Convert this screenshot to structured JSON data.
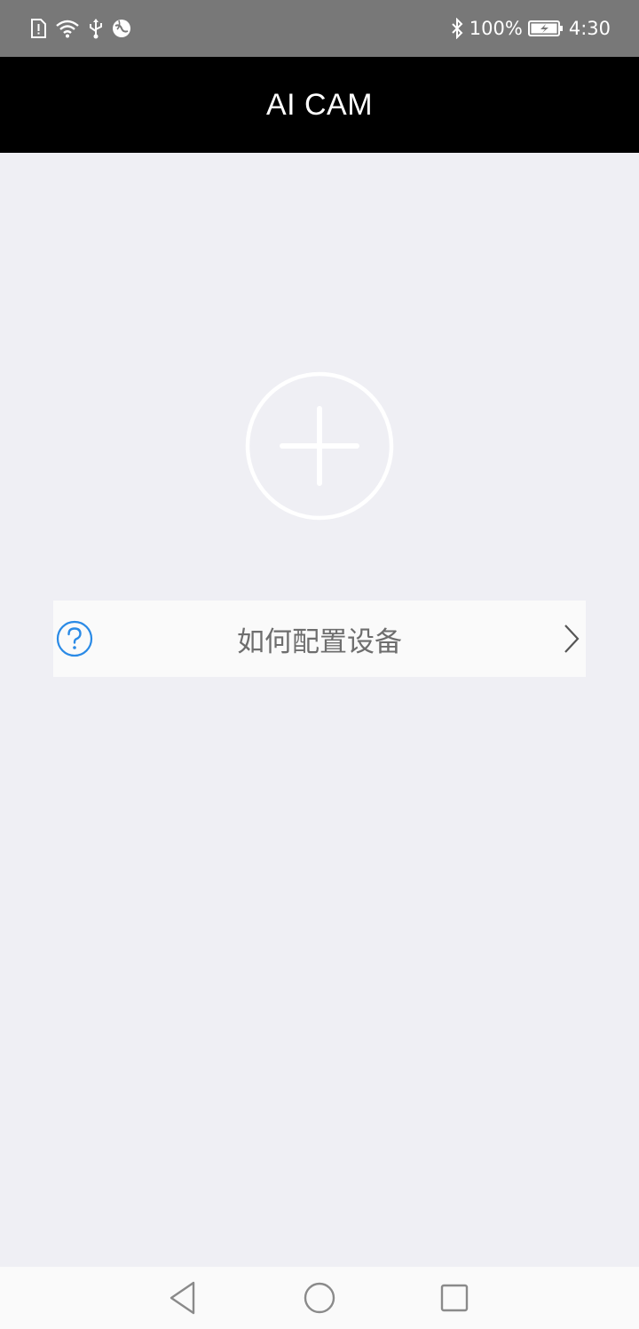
{
  "status_bar": {
    "battery_percent": "100%",
    "time": "4:30",
    "icons": [
      "sim-alert-icon",
      "wifi-icon",
      "usb-icon",
      "globe-icon",
      "bluetooth-icon",
      "battery-charging-icon"
    ]
  },
  "app_bar": {
    "title": "AI CAM"
  },
  "main": {
    "add_button_icon": "plus-circle-icon",
    "help_row": {
      "label": "如何配置设备",
      "icon": "question-circle-icon",
      "accent_color": "#2a8ae6"
    }
  },
  "nav_bar": {
    "buttons": [
      "back",
      "home",
      "recents"
    ]
  }
}
